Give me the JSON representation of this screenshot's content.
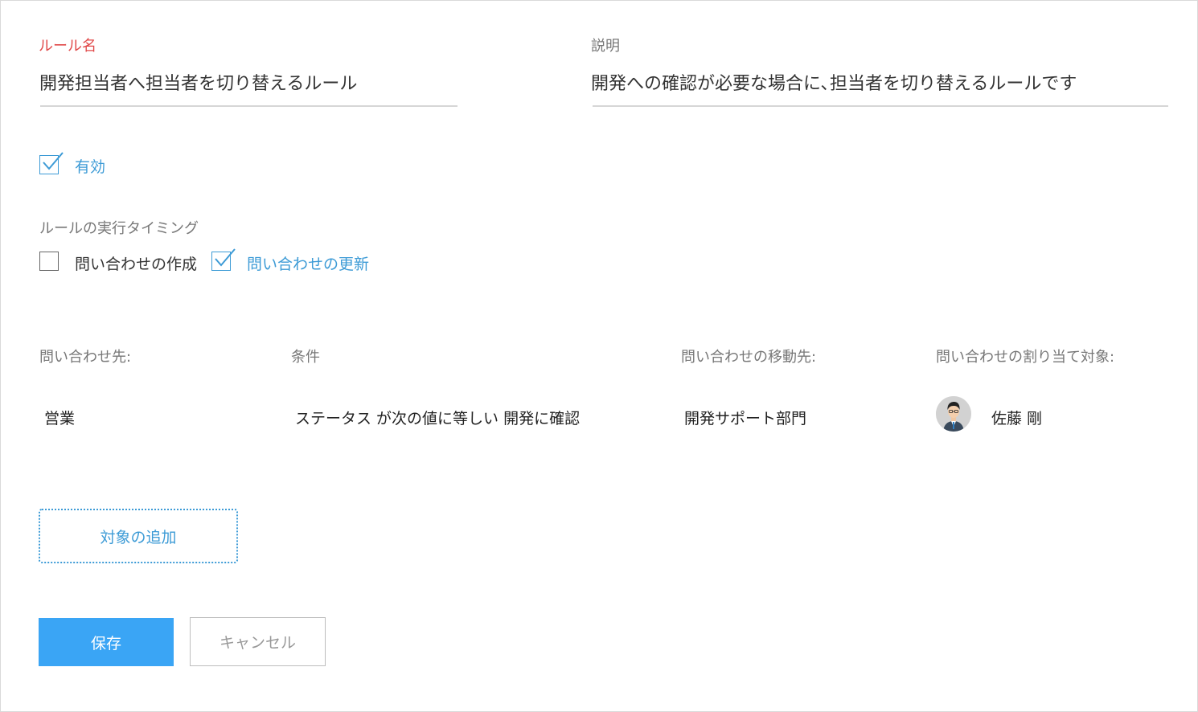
{
  "form": {
    "rule_name_label": "ルール名",
    "rule_name_value": "開発担当者へ担当者を切り替えるルール",
    "description_label": "説明",
    "description_value": "開発への確認が必要な場合に､担当者を切り替えるルールです",
    "enabled_label": "有効",
    "enabled_checked": true,
    "timing_label": "ルールの実行タイミング",
    "timing_options": [
      {
        "label": "問い合わせの作成",
        "checked": false
      },
      {
        "label": "問い合わせの更新",
        "checked": true
      }
    ]
  },
  "table": {
    "headers": [
      "問い合わせ先:",
      "条件",
      "問い合わせの移動先:",
      "問い合わせの割り当て対象:"
    ],
    "rows": [
      {
        "destination": "営業",
        "condition": "ステータス が次の値に等しい 開発に確認",
        "move_to": "開発サポート部門",
        "assignee": "佐藤 剛",
        "assignee_avatar": "person-avatar-icon"
      }
    ]
  },
  "actions": {
    "add_target_label": "対象の追加",
    "save_label": "保存",
    "cancel_label": "キャンセル"
  },
  "colors": {
    "accent": "#3d9bd6",
    "required_label": "#e04848",
    "primary_button": "#3aa5f5"
  }
}
